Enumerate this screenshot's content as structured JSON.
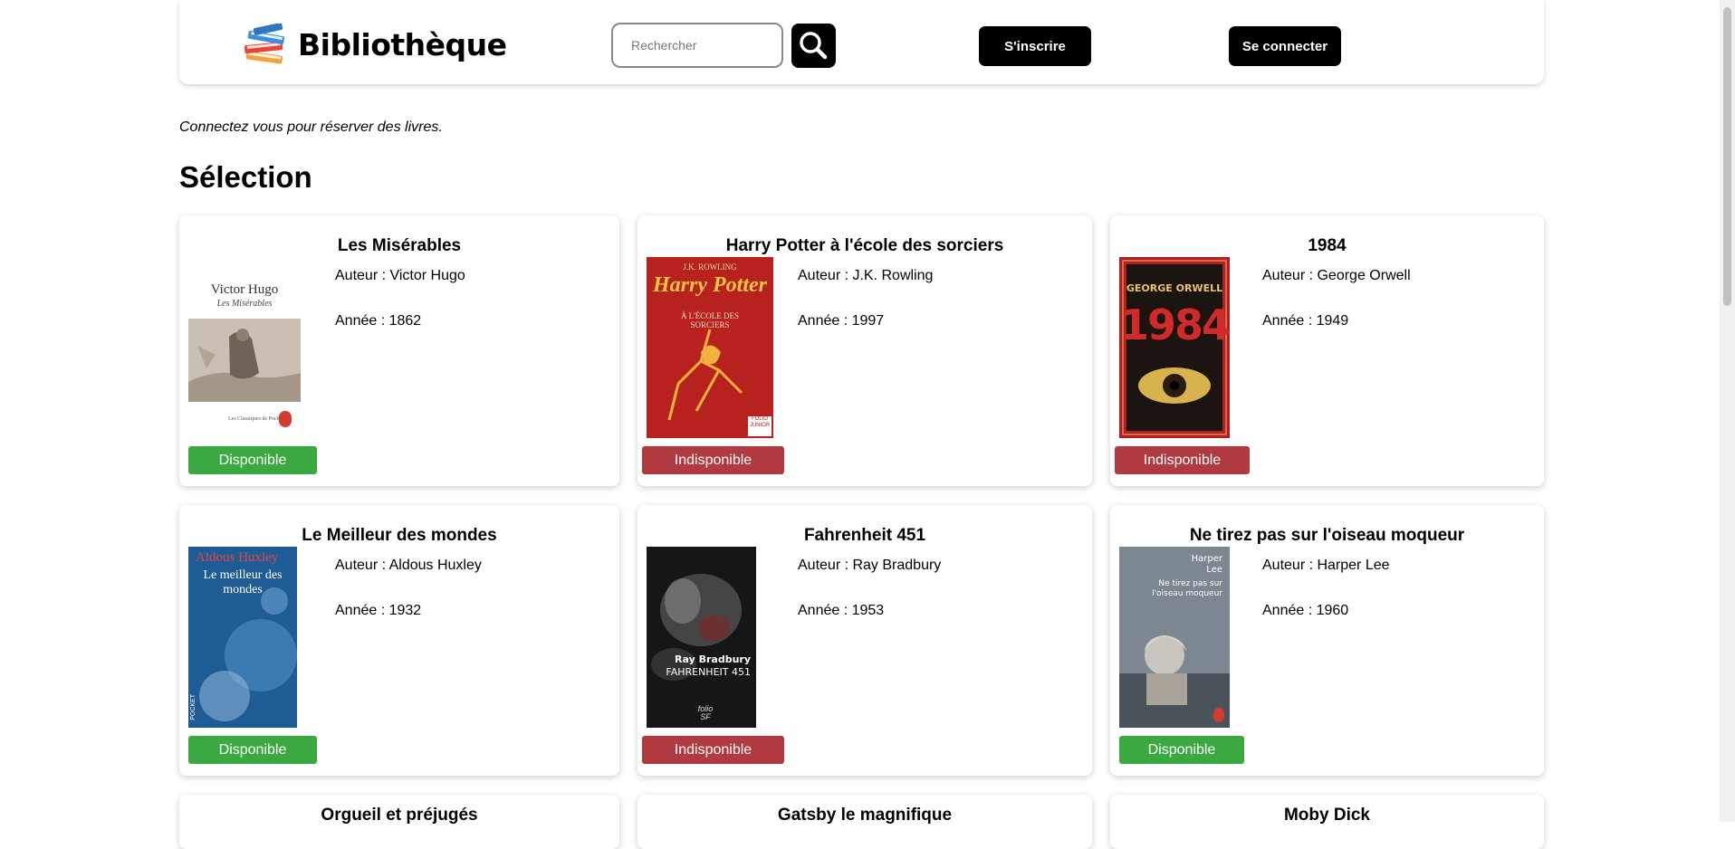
{
  "header": {
    "brand": "Bibliothèque",
    "search_placeholder": "Rechercher",
    "register_label": "S'inscrire",
    "login_label": "Se connecter"
  },
  "notice": "Connectez vous pour réserver des livres.",
  "section_title": "Sélection",
  "books": [
    {
      "title": "Les Misérables",
      "author": "Auteur : Victor Hugo",
      "year": "Année : 1862",
      "status": "Disponible"
    },
    {
      "title": "Harry Potter à l'école des sorciers",
      "author": "Auteur : J.K. Rowling",
      "year": "Année : 1997",
      "status": "Indisponible"
    },
    {
      "title": "1984",
      "author": "Auteur : George Orwell",
      "year": "Année : 1949",
      "status": "Indisponible"
    },
    {
      "title": "Le Meilleur des mondes",
      "author": "Auteur : Aldous Huxley",
      "year": "Année : 1932",
      "status": "Disponible"
    },
    {
      "title": "Fahrenheit 451",
      "author": "Auteur : Ray Bradbury",
      "year": "Année : 1953",
      "status": "Indisponible"
    },
    {
      "title": "Ne tirez pas sur l'oiseau moqueur",
      "author": "Auteur : Harper Lee",
      "year": "Année : 1960",
      "status": "Disponible"
    },
    {
      "title": "Orgueil et préjugés"
    },
    {
      "title": "Gatsby le magnifique"
    },
    {
      "title": "Moby Dick"
    }
  ],
  "covers": {
    "miserables": {
      "line1": "Victor Hugo",
      "line2": "Les Misérables",
      "line3": "Les Classiques de Poche"
    },
    "potter": {
      "line1": "J.K. ROWLING",
      "line2": "Harry Potter",
      "line3": "À L'ÉCOLE DES SORCIERS",
      "badge": "FOLIO JUNIOR"
    },
    "orwell": {
      "line1": "GEORGE ORWELL",
      "line2": "1984"
    },
    "huxley": {
      "line1": "Aldous Huxley",
      "line2": "Le meilleur des mondes",
      "badge": "POCKET"
    },
    "bradbury": {
      "line1": "Ray Bradbury",
      "line2": "FAHRENHEIT 451",
      "badge": "folio SF"
    },
    "lee": {
      "line1": "Harper Lee",
      "line2": "Ne tirez pas sur l'oiseau moqueur"
    }
  },
  "colors": {
    "available": "#3aa93f",
    "unavailable": "#b03a3f",
    "button": "#000000"
  },
  "icons": {
    "logo": "books-stack-icon",
    "search": "magnifier-icon"
  }
}
